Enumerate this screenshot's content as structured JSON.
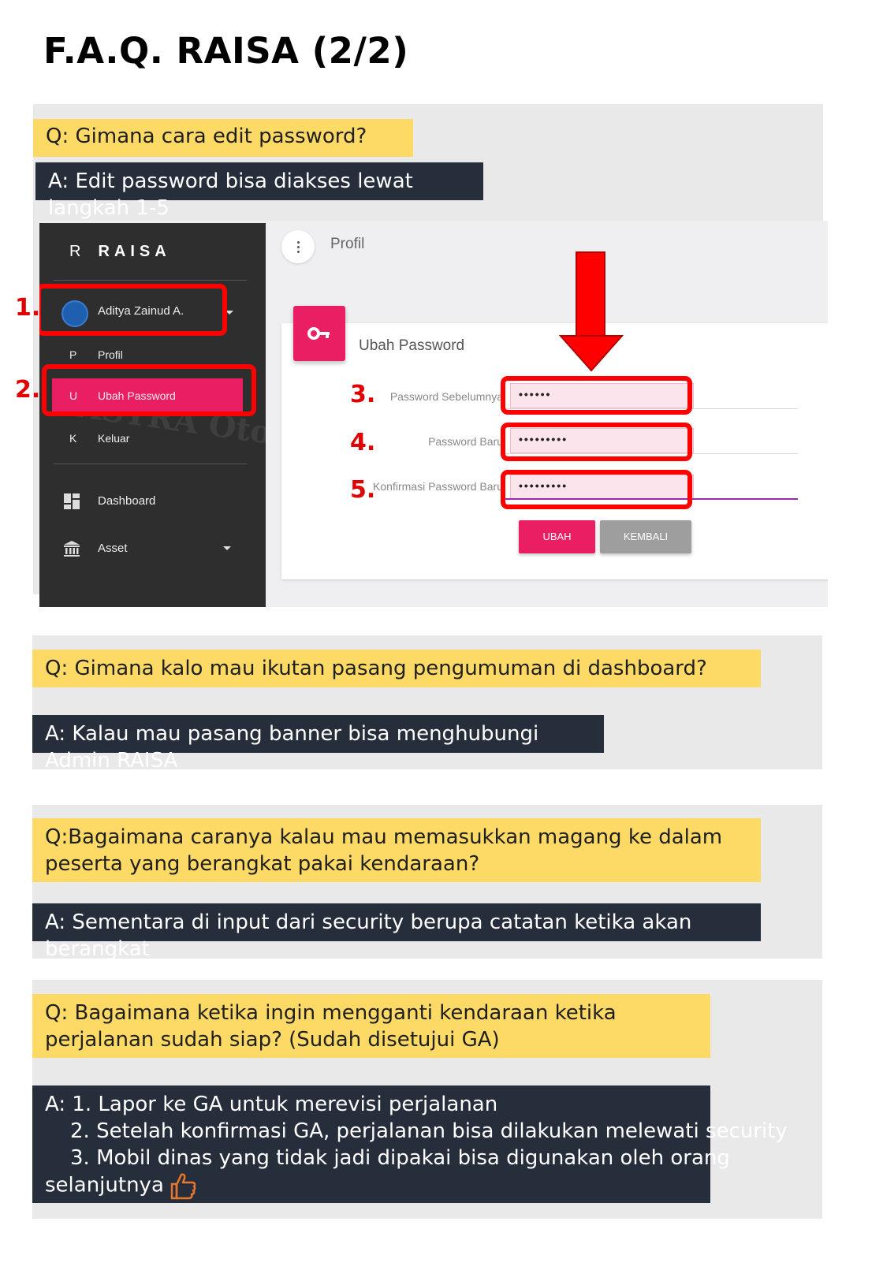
{
  "title": "F.A.Q. RAISA (2/2)",
  "faq": [
    {
      "question": "Q: Gimana cara edit password?",
      "answer": "A: Edit password bisa diakses lewat langkah 1-5"
    },
    {
      "question": "Q: Gimana kalo mau ikutan pasang pengumuman di dashboard?",
      "answer": "A: Kalau mau pasang banner bisa menghubungi Admin RAISA"
    },
    {
      "question": "Q:Bagaimana caranya kalau mau memasukkan magang ke dalam peserta yang berangkat pakai kendaraan?",
      "answer": "A: Sementara di input dari security berupa catatan ketika akan berangkat"
    },
    {
      "question": "Q: Bagaimana ketika ingin mengganti kendaraan ketika perjalanan sudah siap? (Sudah disetujui GA)",
      "answer_lines": [
        "A: 1. Lapor ke GA untuk merevisi perjalanan",
        "2. Setelah konfirmasi GA, perjalanan bisa dilakukan melewati security",
        "3. Mobil dinas yang tidak jadi dipakai bisa digunakan oleh orang",
        "selanjutnya"
      ],
      "emoji": "thumbs-up-icon"
    }
  ],
  "screenshot": {
    "sidebar": {
      "brand_letter": "R",
      "brand_name": "RAISA",
      "user_name": "Aditya Zainud A.",
      "items": [
        {
          "key": "P",
          "label": "Profil"
        },
        {
          "key": "U",
          "label": "Ubah Password",
          "active": true
        },
        {
          "key": "K",
          "label": "Keluar"
        },
        {
          "icon": "dashboard-icon",
          "label": "Dashboard"
        },
        {
          "icon": "bank-icon",
          "label": "Asset"
        }
      ],
      "watermark": "ASTRA Otoparts DIVISI WINTEQ",
      "accent_color": "#e91e63"
    },
    "header_title": "Profil",
    "panel_title": "Ubah Password",
    "fields": [
      {
        "step": "3.",
        "label": "Password Sebelumnya",
        "value": "••••••"
      },
      {
        "step": "4.",
        "label": "Password Baru",
        "value": "•••••••••"
      },
      {
        "step": "5.",
        "label": "Konfirmasi Password Baru",
        "value": "•••••••••"
      }
    ],
    "steps_sidebar": [
      "1.",
      "2."
    ],
    "buttons": {
      "submit": "UBAH",
      "back": "KEMBALI"
    },
    "highlight_color": "#ff0000"
  }
}
